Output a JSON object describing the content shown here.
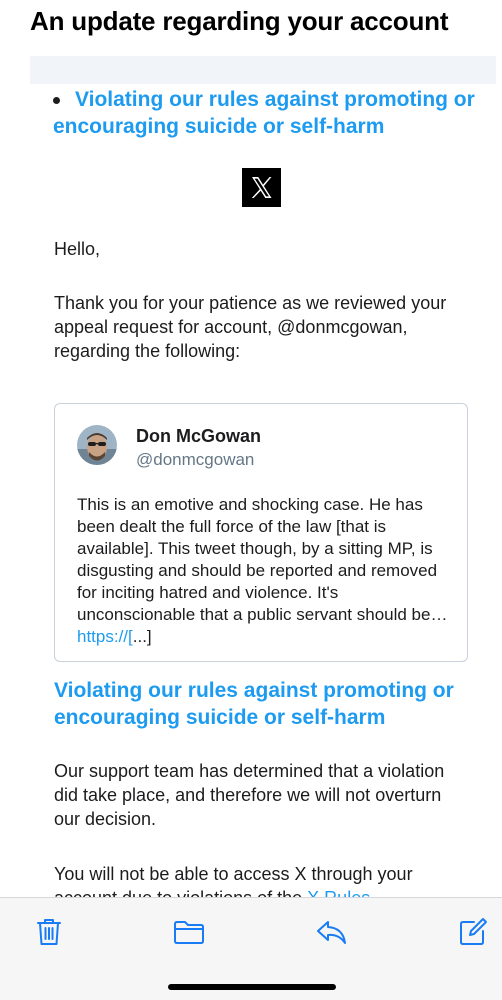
{
  "email": {
    "subject": "An update regarding your account",
    "bullet_violation": "Violating our rules against promoting or encouraging suicide or self-harm",
    "logo_icon": "x-logo",
    "greeting": "Hello,",
    "intro": "Thank you for your patience as we reviewed your appeal request for account, @donmcgowan, regarding the following:",
    "tweet": {
      "author_name": "Don McGowan",
      "author_handle": "@donmcgowan",
      "body": "This is an emotive and shocking case. He has been dealt the full force of the law [that is available]. This tweet though, by a sitting MP, is disgusting and should be reported and removed for inciting hatred and violence. It's unconscionable that a public servant should be… ",
      "link_text": "https://[",
      "trailing": "...]"
    },
    "violation_heading": "Violating our rules against promoting or encouraging suicide or self-harm",
    "decision": "Our support team has determined that a violation did take place, and therefore we will not overturn our decision.",
    "access_text": "You will not be able to access X through your account due to violations of the ",
    "rules_link": "X Rules"
  },
  "toolbar": {
    "items": [
      "trash-icon",
      "folder-icon",
      "reply-icon",
      "compose-icon"
    ]
  },
  "colors": {
    "link": "#1d9bf0",
    "text": "#1c1c1e",
    "handle": "#657786",
    "toolbar_icon": "#1a7cf5",
    "card_border": "#c9d1da"
  }
}
